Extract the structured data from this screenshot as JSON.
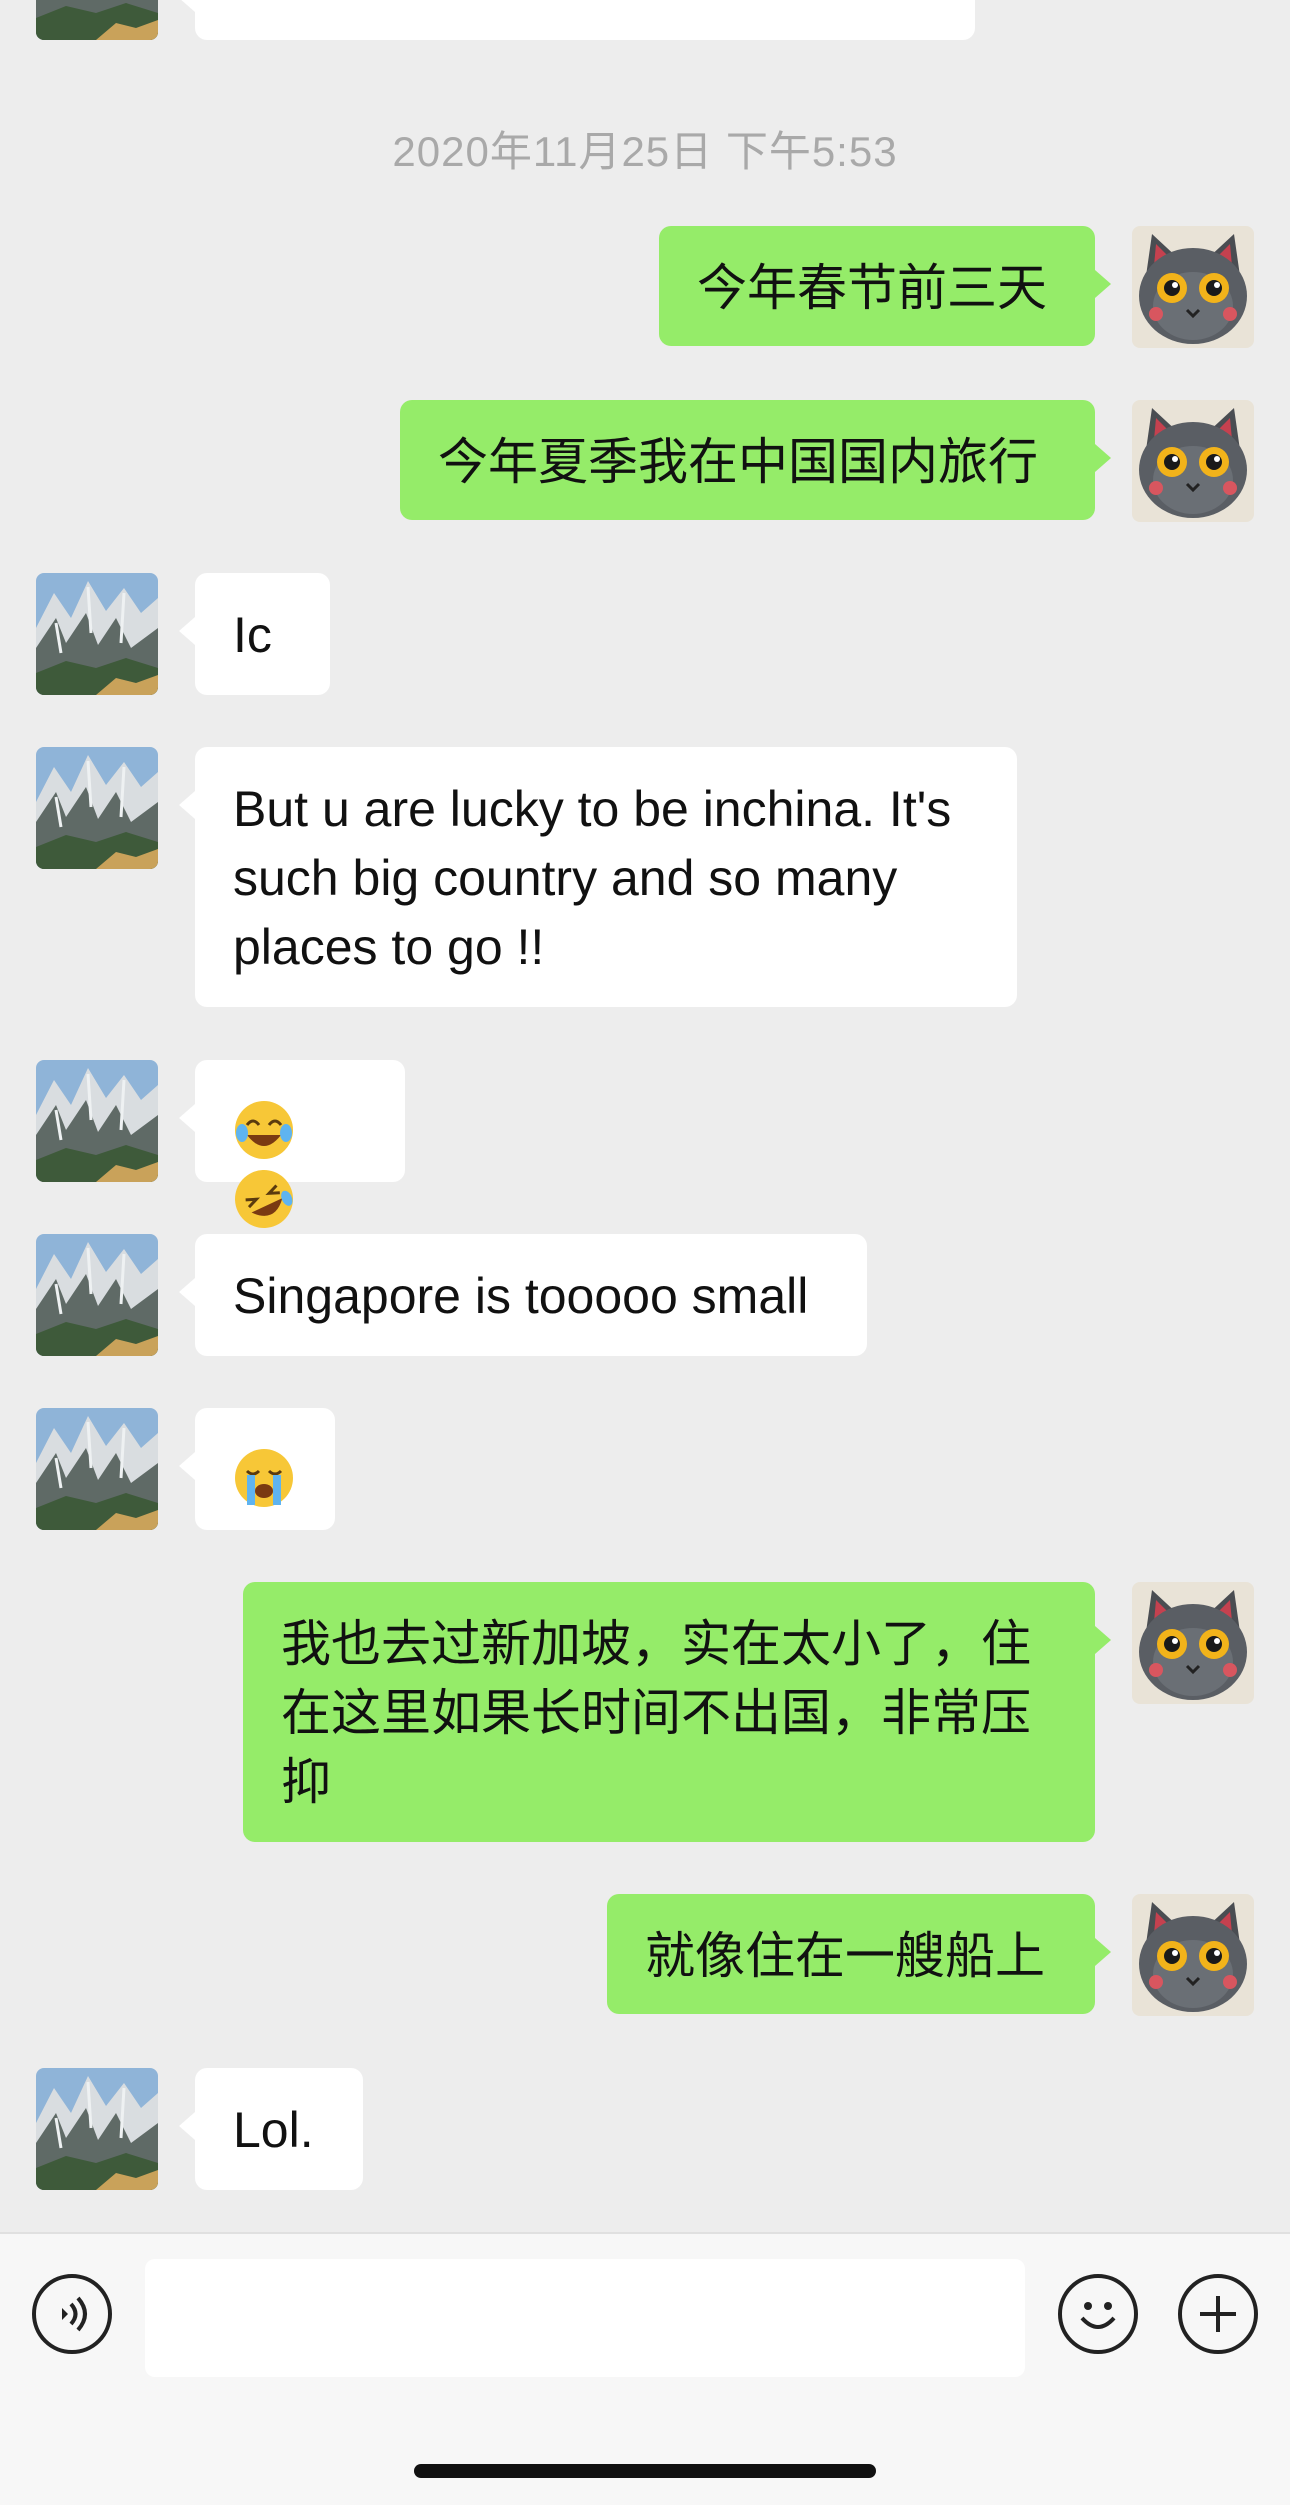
{
  "chat": {
    "timestamp": "2020年11月25日 下午5:53",
    "messages": [
      {
        "side": "out",
        "text": "今年春节前三天"
      },
      {
        "side": "out",
        "text": "今年夏季我在中国国内旅行"
      },
      {
        "side": "in",
        "text": "Ic"
      },
      {
        "side": "in",
        "text": "But u are lucky to be inchina. It's such big country and so many places to go !!"
      },
      {
        "side": "in",
        "emoji": [
          "joy-emoji",
          "rofl-emoji"
        ]
      },
      {
        "side": "in",
        "text": "Singapore is tooooo small"
      },
      {
        "side": "in",
        "emoji": [
          "crying-emoji"
        ]
      },
      {
        "side": "out",
        "text": "我也去过新加坡，实在太小了，住在这里如果长时间不出国，非常压抑"
      },
      {
        "side": "out",
        "text": "就像住在一艘船上"
      },
      {
        "side": "in",
        "text": "Lol."
      }
    ]
  },
  "colors": {
    "background": "#ededed",
    "outgoing_bubble": "#95ec69",
    "incoming_bubble": "#ffffff"
  },
  "input_bar": {
    "voice_icon": "voice-icon",
    "emoji_icon": "emoji-icon",
    "plus_icon": "plus-icon"
  }
}
